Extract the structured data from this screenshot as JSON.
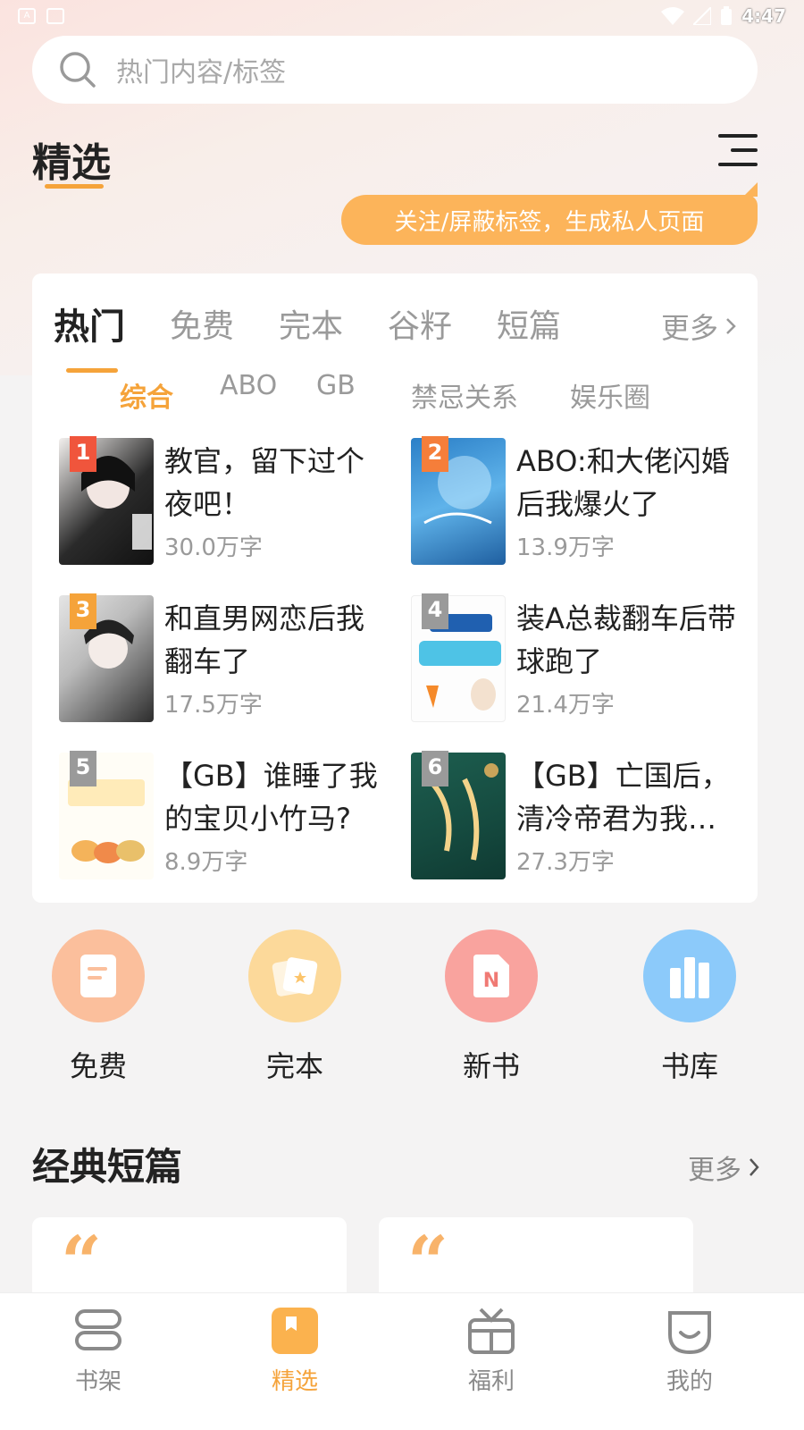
{
  "status_bar": {
    "time": "4:47"
  },
  "search": {
    "placeholder": "热门内容/标签"
  },
  "header": {
    "title": "精选",
    "tip": "关注/屏蔽标签，生成私人页面"
  },
  "tabs": [
    {
      "label": "热门",
      "active": true
    },
    {
      "label": "免费"
    },
    {
      "label": "完本"
    },
    {
      "label": "谷籽"
    },
    {
      "label": "短篇"
    }
  ],
  "tabs_more": "更多",
  "subtabs": [
    {
      "label": "综合",
      "active": true
    },
    {
      "label": "ABO"
    },
    {
      "label": "GB"
    },
    {
      "label": "禁忌关系"
    },
    {
      "label": "娱乐圈"
    }
  ],
  "books": [
    {
      "rank": "1",
      "title": "教官，留下过个夜吧！",
      "words": "30.0万字",
      "rank_color": "#f0553c"
    },
    {
      "rank": "2",
      "title": "ABO:和大佬闪婚后我爆火了",
      "words": "13.9万字",
      "rank_color": "#f57e3a"
    },
    {
      "rank": "3",
      "title": "和直男网恋后我翻车了",
      "words": "17.5万字",
      "rank_color": "#f5a33a"
    },
    {
      "rank": "4",
      "title": "装A总裁翻车后带球跑了",
      "words": "21.4万字",
      "rank_color": "#9a9a9a"
    },
    {
      "rank": "5",
      "title": "【GB】谁睡了我的宝贝小竹马?",
      "words": "8.9万字",
      "rank_color": "#9a9a9a"
    },
    {
      "rank": "6",
      "title": "【GB】亡国后，清冷帝君为我…",
      "words": "27.3万字",
      "rank_color": "#9a9a9a"
    }
  ],
  "quick_links": [
    {
      "label": "免费",
      "icon": "document-icon",
      "color": "#fbbf9c"
    },
    {
      "label": "完本",
      "icon": "cards-icon",
      "color": "#fcd99a"
    },
    {
      "label": "新书",
      "icon": "new-book-icon",
      "color": "#f9a39e"
    },
    {
      "label": "书库",
      "icon": "library-icon",
      "color": "#8ccafa"
    }
  ],
  "section": {
    "title": "经典短篇",
    "more": "更多",
    "quote": "“"
  },
  "bottom_nav": [
    {
      "label": "书架",
      "icon": "bookshelf-icon"
    },
    {
      "label": "精选",
      "icon": "featured-icon",
      "active": true
    },
    {
      "label": "福利",
      "icon": "gift-icon"
    },
    {
      "label": "我的",
      "icon": "profile-icon"
    }
  ],
  "accent_color": "#f5a33a"
}
